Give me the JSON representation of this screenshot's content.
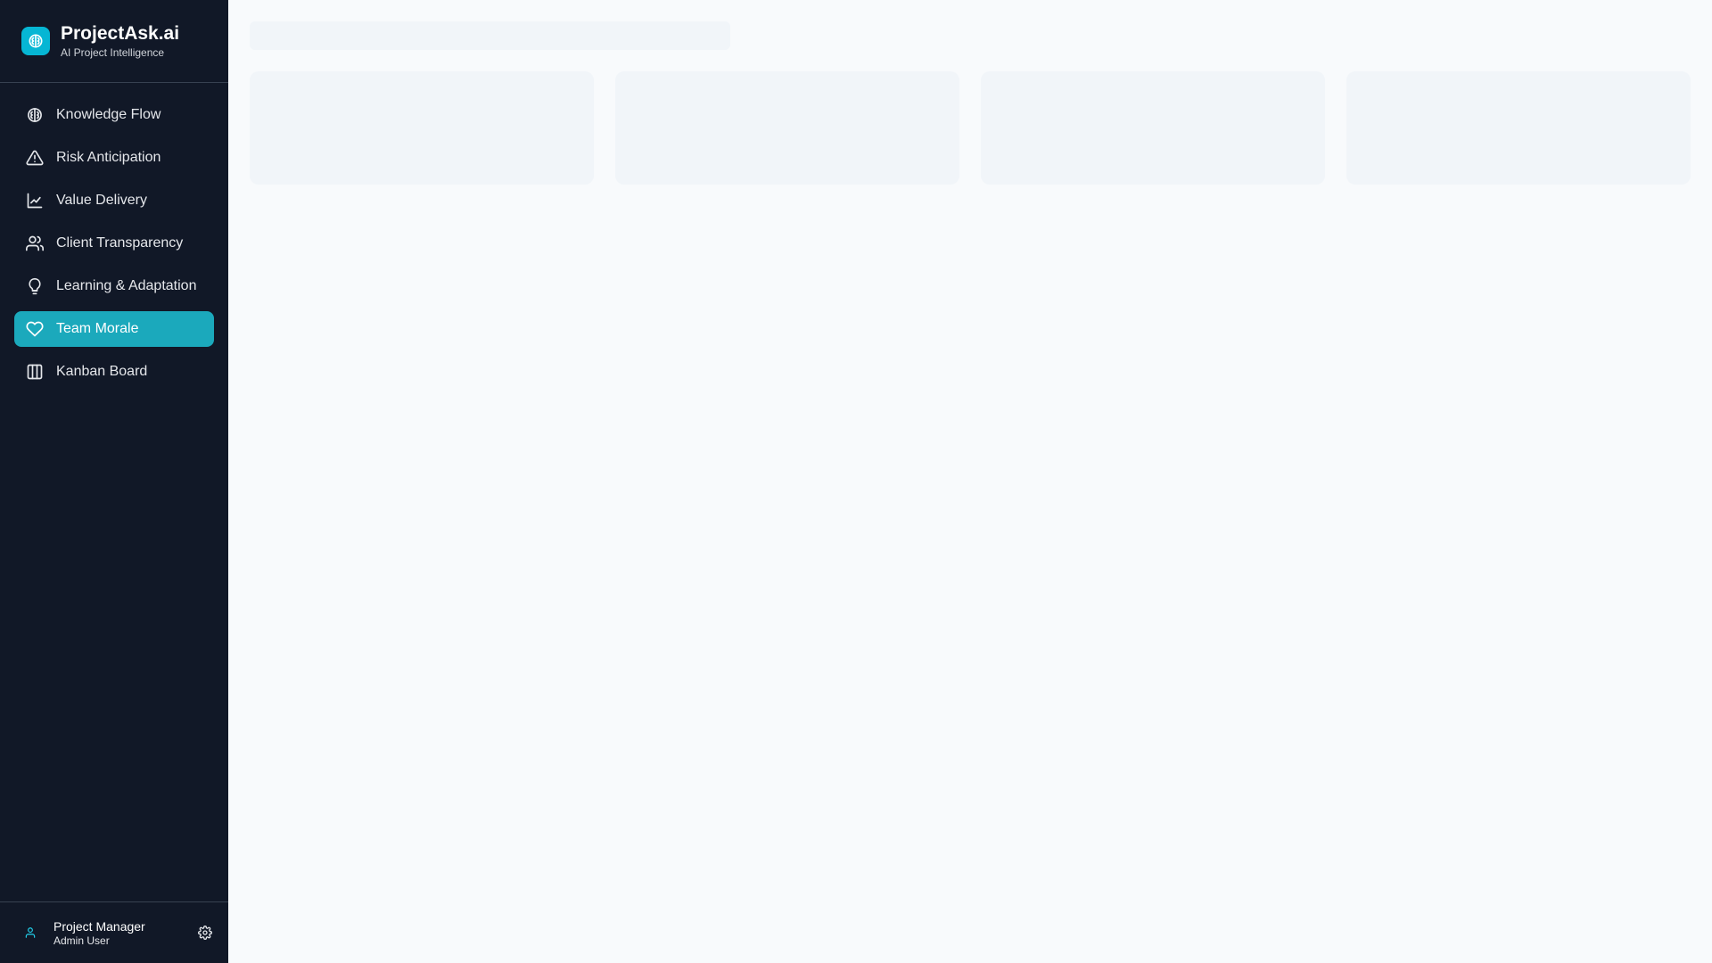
{
  "brand": {
    "title": "ProjectAsk.ai",
    "subtitle": "AI Project Intelligence",
    "logo_icon": "brain-icon",
    "accent": "#06b6d4"
  },
  "sidebar": {
    "items": [
      {
        "label": "Knowledge Flow",
        "icon": "brain-icon",
        "active": false
      },
      {
        "label": "Risk Anticipation",
        "icon": "alert-triangle-icon",
        "active": false
      },
      {
        "label": "Value Delivery",
        "icon": "line-chart-icon",
        "active": false
      },
      {
        "label": "Client Transparency",
        "icon": "users-icon",
        "active": false
      },
      {
        "label": "Learning & Adaptation",
        "icon": "lightbulb-icon",
        "active": false
      },
      {
        "label": "Team Morale",
        "icon": "heart-icon",
        "active": true
      },
      {
        "label": "Kanban Board",
        "icon": "columns-icon",
        "active": false
      }
    ],
    "active_color": "#1ba9bc",
    "background": "#111827"
  },
  "user": {
    "role": "Project Manager",
    "name": "Admin User",
    "avatar_icon": "user-icon",
    "settings_icon": "gear-icon"
  },
  "main": {
    "state": "loading",
    "skeleton_color": "#f1f5f9"
  }
}
